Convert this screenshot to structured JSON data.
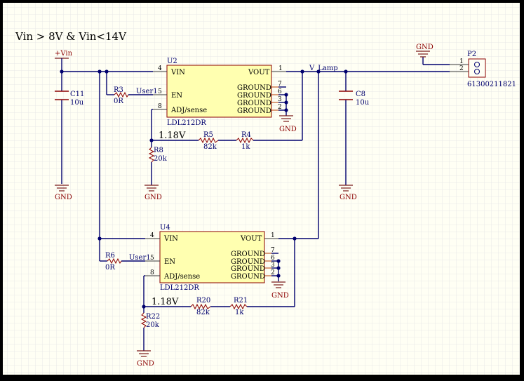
{
  "note": "Vin > 8V & Vin<14V",
  "nets": {
    "vin": "+Vin",
    "vlamp": "V_Lamp",
    "user1": "User1",
    "gnd": "GND",
    "ref_voltage": "1.18V"
  },
  "ic_u2": {
    "designator": "U2",
    "part": "LDL212DR",
    "pins": [
      {
        "num": "4",
        "name": "VIN"
      },
      {
        "num": "5",
        "name": "EN"
      },
      {
        "num": "8",
        "name": "ADJ/sense"
      },
      {
        "num": "1",
        "name": "VOUT"
      },
      {
        "num": "7",
        "name": "GROUND"
      },
      {
        "num": "6",
        "name": "GROUND"
      },
      {
        "num": "3",
        "name": "GROUND"
      },
      {
        "num": "2",
        "name": "GROUND"
      }
    ]
  },
  "ic_u4": {
    "designator": "U4",
    "part": "LDL212DR",
    "pins": [
      {
        "num": "4",
        "name": "VIN"
      },
      {
        "num": "5",
        "name": "EN"
      },
      {
        "num": "8",
        "name": "ADJ/sense"
      },
      {
        "num": "1",
        "name": "VOUT"
      },
      {
        "num": "7",
        "name": "GROUND"
      },
      {
        "num": "6",
        "name": "GROUND"
      },
      {
        "num": "3",
        "name": "GROUND"
      },
      {
        "num": "2",
        "name": "GROUND"
      }
    ]
  },
  "connector": {
    "designator": "P2",
    "part": "61300211821",
    "pins": [
      "1",
      "2"
    ]
  },
  "components": {
    "c11": {
      "ref": "C11",
      "value": "10u"
    },
    "c8": {
      "ref": "C8",
      "value": "10u"
    },
    "r3": {
      "ref": "R3",
      "value": "0R"
    },
    "r4": {
      "ref": "R4",
      "value": "1k"
    },
    "r5": {
      "ref": "R5",
      "value": "82k"
    },
    "r6": {
      "ref": "R6",
      "value": "0R"
    },
    "r8": {
      "ref": "R8",
      "value": "20k"
    },
    "r20": {
      "ref": "R20",
      "value": "82k"
    },
    "r21": {
      "ref": "R21",
      "value": "1k"
    },
    "r22": {
      "ref": "R22",
      "value": "20k"
    }
  },
  "colors": {
    "background": "#fffff4",
    "grid": "#e4e4e4",
    "wire": "#00006e",
    "ic_fill": "#ffffb0",
    "ic_border": "#8b0000",
    "power_label": "#8b0000"
  }
}
